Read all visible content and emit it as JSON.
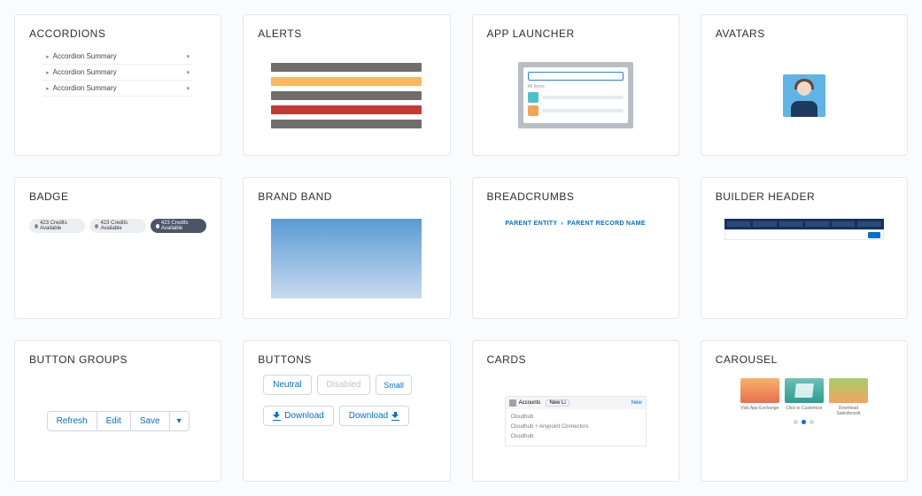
{
  "cards": {
    "accordions": {
      "title": "ACCORDIONS",
      "rows": [
        "Accordion Summary",
        "Accordion Summary",
        "Accordion Summary"
      ]
    },
    "alerts": {
      "title": "ALERTS"
    },
    "app_launcher": {
      "title": "APP LAUNCHER"
    },
    "avatars": {
      "title": "AVATARS"
    },
    "badge": {
      "title": "BADGE",
      "items": [
        "423 Credits Available",
        "423 Credits Available",
        "423 Credits Available"
      ]
    },
    "brand_band": {
      "title": "BRAND BAND"
    },
    "breadcrumbs": {
      "title": "BREADCRUMBS",
      "parent": "PARENT ENTITY",
      "child": "PARENT RECORD NAME"
    },
    "builder_header": {
      "title": "BUILDER HEADER"
    },
    "button_groups": {
      "title": "BUTTON GROUPS",
      "refresh": "Refresh",
      "edit": "Edit",
      "save": "Save"
    },
    "buttons": {
      "title": "BUTTONS",
      "neutral": "Neutral",
      "disabled": "Disabled",
      "small": "Small",
      "download": "Download"
    },
    "cards_comp": {
      "title": "CARDS",
      "heading": "Accounts",
      "search": "New Li",
      "action": "New",
      "lines": [
        "Cloudhub",
        "Cloudhub + Anypoint Connectors",
        "Cloudhub"
      ]
    },
    "carousel": {
      "title": "CAROUSEL",
      "caps": [
        "Visit App Exchange",
        "Click to Customize",
        "Download SalesforceA"
      ]
    }
  },
  "alert_colors": [
    "#706e6b",
    "#ffb75d",
    "#706e6b",
    "#c23934",
    "#706e6b"
  ]
}
